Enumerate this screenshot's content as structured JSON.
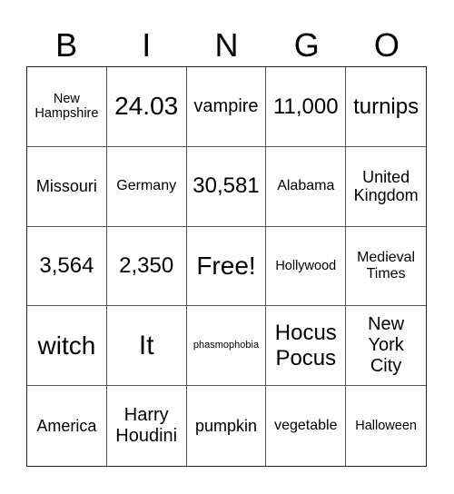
{
  "header": {
    "letters": [
      "B",
      "I",
      "N",
      "G",
      "O"
    ]
  },
  "cells": [
    "New Hampshire",
    "24.03",
    "vampire",
    "11,000",
    "turnips",
    "Missouri",
    "Germany",
    "30,581",
    "Alabama",
    "United Kingdom",
    "3,564",
    "2,350",
    "Free!",
    "Hollywood",
    "Medieval Times",
    "witch",
    "It",
    "phasmophobia",
    "Hocus Pocus",
    "New York City",
    "America",
    "Harry Houdini",
    "pumpkin",
    "vegetable",
    "Halloween"
  ]
}
